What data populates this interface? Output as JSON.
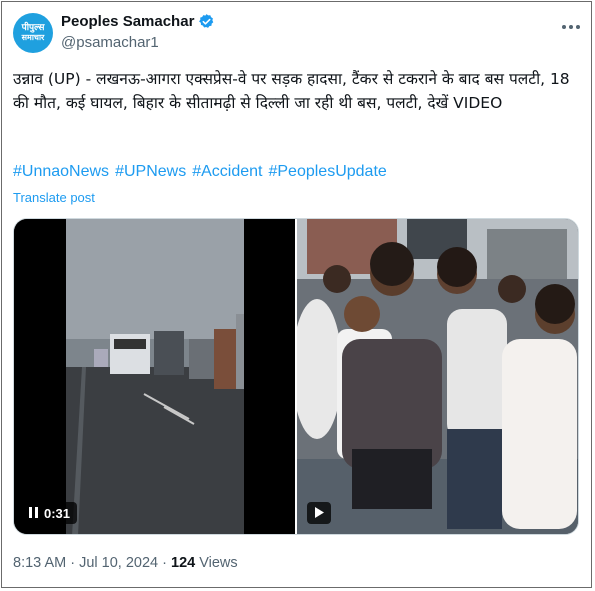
{
  "author": {
    "avatar_line1": "पीपुल्स",
    "avatar_line2": "समाचार",
    "name": "Peoples Samachar",
    "handle": "@psamachar1",
    "verified_icon": "verified-badge-icon",
    "more_icon": "more-options-icon"
  },
  "post": {
    "text": "उन्नाव (UP) - लखनऊ-आगरा एक्सप्रेस-वे  पर सड़क हादसा, टैंकर से टकराने के बाद बस पलटी, 18 की मौत, कई घायल, बिहार के सीतामढ़ी से दिल्ली जा रही थी बस,  पलटी, देखें VIDEO",
    "hashtags": [
      "#UnnaoNews",
      "#UPNews",
      "#Accident",
      "#PeoplesUpdate"
    ],
    "translate_label": "Translate post"
  },
  "media": {
    "video1_duration": "0:31",
    "video1_icon": "pause-icon",
    "video2_icon": "play-icon"
  },
  "footer": {
    "time": "8:13 AM",
    "separator": " · ",
    "date": "Jul 10, 2024",
    "separator2": " · ",
    "views_count": "124",
    "views_label": " Views"
  },
  "colors": {
    "link": "#1d9bf0",
    "secondary_text": "#536471",
    "avatar_bg": "#1fa0df"
  }
}
